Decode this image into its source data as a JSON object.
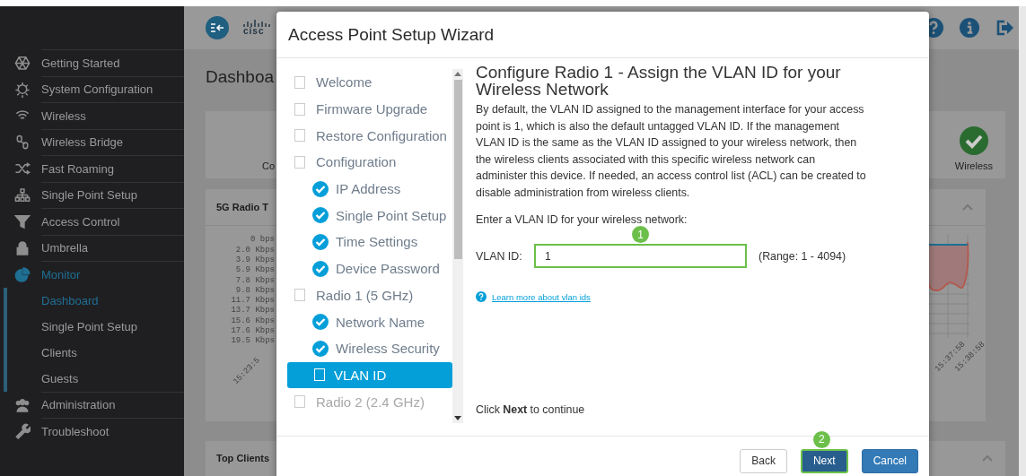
{
  "top_bar": {
    "logo": "cisc"
  },
  "sidebar": {
    "items": [
      {
        "label": "Getting Started",
        "selected": false
      },
      {
        "label": "System Configuration",
        "selected": false
      },
      {
        "label": "Wireless",
        "selected": false
      },
      {
        "label": "Wireless Bridge",
        "selected": false
      },
      {
        "label": "Fast Roaming",
        "selected": false
      },
      {
        "label": "Single Point Setup",
        "selected": false
      },
      {
        "label": "Access Control",
        "selected": false
      },
      {
        "label": "Umbrella",
        "selected": false
      },
      {
        "label": "Monitor",
        "selected": true,
        "children": [
          {
            "label": "Dashboard",
            "selected": true
          },
          {
            "label": "Single Point Setup",
            "selected": false
          },
          {
            "label": "Clients",
            "selected": false
          },
          {
            "label": "Guests",
            "selected": false
          }
        ]
      },
      {
        "label": "Administration",
        "selected": false
      },
      {
        "label": "Troubleshoot",
        "selected": false
      }
    ]
  },
  "page": {
    "title": "Dashboa",
    "status_cards": [
      {
        "label": "Co"
      },
      {
        "label": "Wireless"
      }
    ],
    "chart_panel": {
      "title": "5G Radio T",
      "y_labels": [
        "0 bps",
        "2.0 Kbps",
        "3.9 Kbps",
        "5.9 Kbps",
        "7.8 Kbps",
        "9.8 Kbps",
        "11.7 Kbps",
        "13.7 Kbps",
        "15.6 Kbps",
        "17.6 Kbps",
        "19.5 Kbps"
      ],
      "x_labels": [
        "15:23:5",
        "15:37:58",
        "15:38:58"
      ]
    },
    "bottom_panel": {
      "title": "Top Clients"
    }
  },
  "wizard": {
    "title": "Access Point Setup Wizard",
    "steps": [
      {
        "label": "Welcome",
        "done": false,
        "selected": false,
        "disabled": false
      },
      {
        "label": "Firmware Upgrade",
        "done": false,
        "selected": false,
        "disabled": false
      },
      {
        "label": "Restore Configuration",
        "done": false,
        "selected": false,
        "disabled": false
      },
      {
        "label": "Configuration",
        "done": false,
        "selected": false,
        "disabled": false,
        "children": [
          {
            "label": "IP Address",
            "done": true,
            "selected": false,
            "disabled": false
          },
          {
            "label": "Single Point Setup",
            "done": true,
            "selected": false,
            "disabled": false
          },
          {
            "label": "Time Settings",
            "done": true,
            "selected": false,
            "disabled": false
          },
          {
            "label": "Device Password",
            "done": true,
            "selected": false,
            "disabled": false
          }
        ]
      },
      {
        "label": "Radio 1 (5 GHz)",
        "done": false,
        "selected": false,
        "disabled": false,
        "children": [
          {
            "label": "Network Name",
            "done": true,
            "selected": false,
            "disabled": false
          },
          {
            "label": "Wireless Security",
            "done": true,
            "selected": false,
            "disabled": false
          },
          {
            "label": "VLAN ID",
            "done": false,
            "selected": true,
            "disabled": false
          }
        ]
      },
      {
        "label": "Radio 2 (2.4 GHz)",
        "done": false,
        "selected": false,
        "disabled": true
      }
    ],
    "heading": "Configure Radio 1 - Assign the VLAN ID for your Wireless Network",
    "description": "By default, the VLAN ID assigned to the management interface for your access point is 1, which is also the default untagged VLAN ID. If the management VLAN ID is the same as the VLAN ID assigned to your wireless network, then the wireless clients associated with this specific wireless network can administer this device. If needed, an access control list (ACL) can be created to disable administration from wireless clients.",
    "prompt": "Enter a VLAN ID for your wireless network:",
    "vlan_field": {
      "label": "VLAN ID:",
      "value": "1",
      "range": "(Range: 1 - 4094)",
      "highlighted": true,
      "callout": "1"
    },
    "help_link": "Learn more about vlan ids",
    "hint": "Click **Next** to continue",
    "buttons": [
      {
        "label": "Back",
        "kind": "secondary",
        "highlighted": false
      },
      {
        "label": "Next",
        "kind": "primary",
        "highlighted": true,
        "callout": "2"
      },
      {
        "label": "Cancel",
        "kind": "primary",
        "highlighted": false
      }
    ]
  }
}
